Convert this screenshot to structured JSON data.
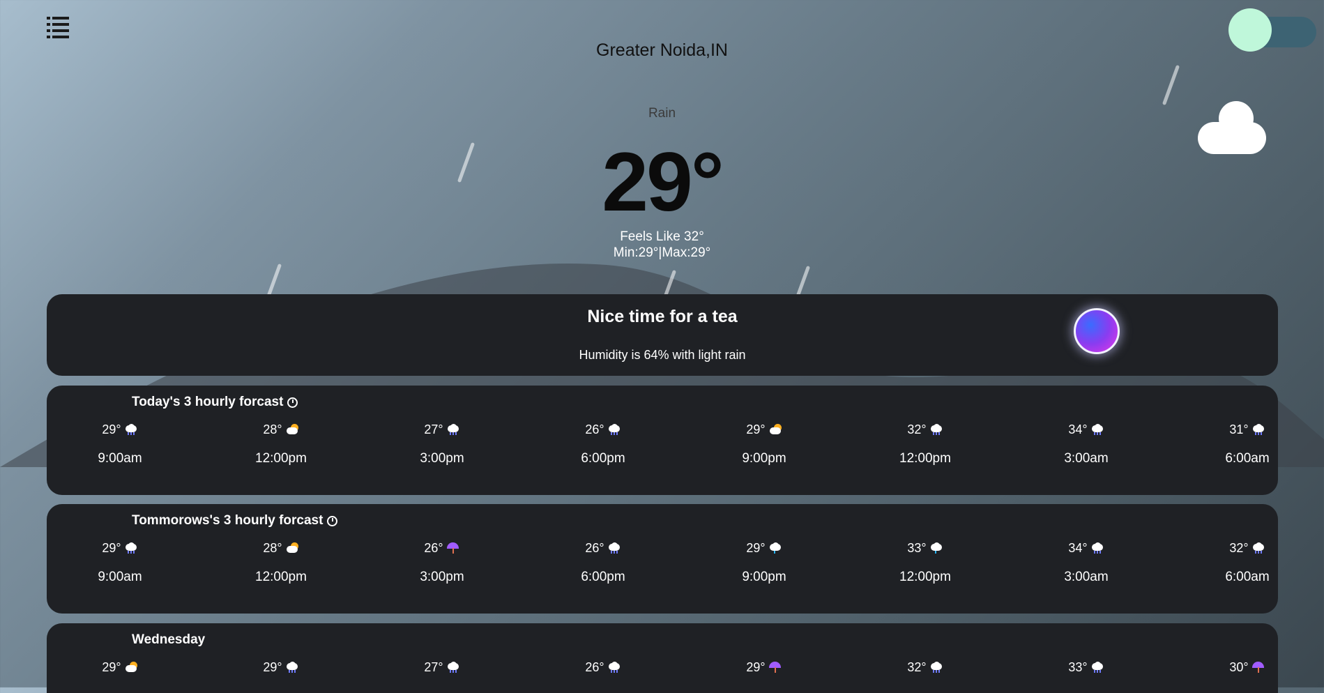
{
  "header": {
    "city": "Greater Noida,IN",
    "condition": "Rain",
    "temperature": "29°",
    "feels_like": "Feels Like 32°",
    "min_max": "Min:29°|Max:29°"
  },
  "icons": {
    "menu": "menu-list-icon",
    "theme_toggle": "theme-toggle",
    "weather": "cloud-icon",
    "assistant": "assistant-orb-icon",
    "clock": "clock-icon"
  },
  "tip": {
    "title": "Nice time for a tea",
    "subtitle": "Humidity is 64% with light rain"
  },
  "forecasts": [
    {
      "heading": "Today's 3 hourly forcast",
      "slots": [
        {
          "temp": "29°",
          "icon": "rain-cloud-icon",
          "time": "9:00am"
        },
        {
          "temp": "28°",
          "icon": "partly-cloudy-icon",
          "time": "12:00pm"
        },
        {
          "temp": "27°",
          "icon": "rain-cloud-icon",
          "time": "3:00pm"
        },
        {
          "temp": "26°",
          "icon": "rain-cloud-icon",
          "time": "6:00pm"
        },
        {
          "temp": "29°",
          "icon": "sun-behind-cloud-icon",
          "time": "9:00pm"
        },
        {
          "temp": "32°",
          "icon": "rain-cloud-icon",
          "time": "12:00pm"
        },
        {
          "temp": "34°",
          "icon": "rain-cloud-icon",
          "time": "3:00am"
        },
        {
          "temp": "31°",
          "icon": "rain-cloud-icon",
          "time": "6:00am"
        }
      ]
    },
    {
      "heading": "Tommorows's 3 hourly forcast",
      "slots": [
        {
          "temp": "29°",
          "icon": "rain-cloud-icon",
          "time": "9:00am"
        },
        {
          "temp": "28°",
          "icon": "partly-cloudy-icon",
          "time": "12:00pm"
        },
        {
          "temp": "26°",
          "icon": "umbrella-icon",
          "time": "3:00pm"
        },
        {
          "temp": "26°",
          "icon": "rain-cloud-icon",
          "time": "6:00pm"
        },
        {
          "temp": "29°",
          "icon": "drizzle-cloud-icon",
          "time": "9:00pm"
        },
        {
          "temp": "33°",
          "icon": "drizzle-cloud-icon",
          "time": "12:00pm"
        },
        {
          "temp": "34°",
          "icon": "rain-cloud-icon",
          "time": "3:00am"
        },
        {
          "temp": "32°",
          "icon": "rain-cloud-icon",
          "time": "6:00am"
        }
      ]
    },
    {
      "heading": "Wednesday",
      "slots": [
        {
          "temp": "29°",
          "icon": "sun-behind-cloud-icon",
          "time": ""
        },
        {
          "temp": "29°",
          "icon": "rain-cloud-icon",
          "time": ""
        },
        {
          "temp": "27°",
          "icon": "rain-cloud-icon",
          "time": ""
        },
        {
          "temp": "26°",
          "icon": "rain-cloud-icon",
          "time": ""
        },
        {
          "temp": "29°",
          "icon": "umbrella-icon",
          "time": ""
        },
        {
          "temp": "32°",
          "icon": "rain-cloud-icon",
          "time": ""
        },
        {
          "temp": "33°",
          "icon": "rain-cloud-icon",
          "time": ""
        },
        {
          "temp": "30°",
          "icon": "umbrella-icon",
          "time": ""
        }
      ]
    }
  ],
  "colors": {
    "card_bg": "#1f2125",
    "toggle_knob": "#bff7da",
    "toggle_track": "#3d6373"
  }
}
